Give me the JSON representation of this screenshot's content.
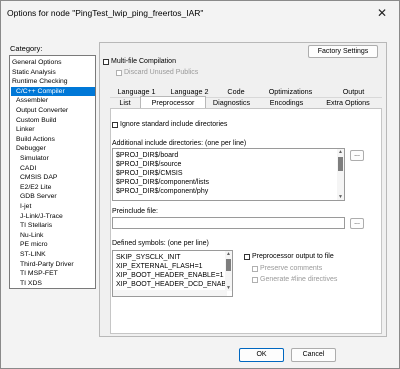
{
  "window": {
    "title": "Options for node \"PingTest_lwip_ping_freertos_IAR\"",
    "close_glyph": "✕"
  },
  "category": {
    "label": "Category:",
    "items": [
      {
        "text": "General Options",
        "indent": 0
      },
      {
        "text": "Static Analysis",
        "indent": 0
      },
      {
        "text": "Runtime Checking",
        "indent": 0
      },
      {
        "text": "C/C++ Compiler",
        "indent": 1,
        "selected": true
      },
      {
        "text": "Assembler",
        "indent": 1
      },
      {
        "text": "Output Converter",
        "indent": 1
      },
      {
        "text": "Custom Build",
        "indent": 1
      },
      {
        "text": "Linker",
        "indent": 1
      },
      {
        "text": "Build Actions",
        "indent": 1
      },
      {
        "text": "Debugger",
        "indent": 1
      },
      {
        "text": "Simulator",
        "indent": 2
      },
      {
        "text": "CADI",
        "indent": 2
      },
      {
        "text": "CMSIS DAP",
        "indent": 2
      },
      {
        "text": "E2/E2 Lite",
        "indent": 2
      },
      {
        "text": "GDB Server",
        "indent": 2
      },
      {
        "text": "I-jet",
        "indent": 2
      },
      {
        "text": "J-Link/J-Trace",
        "indent": 2
      },
      {
        "text": "TI Stellaris",
        "indent": 2
      },
      {
        "text": "Nu-Link",
        "indent": 2
      },
      {
        "text": "PE micro",
        "indent": 2
      },
      {
        "text": "ST-LINK",
        "indent": 2
      },
      {
        "text": "Third-Party Driver",
        "indent": 2
      },
      {
        "text": "TI MSP-FET",
        "indent": 2
      },
      {
        "text": "TI XDS",
        "indent": 2
      }
    ]
  },
  "panel": {
    "factory_settings": "Factory Settings",
    "multifile": "Multi-file Compilation",
    "discard": "Discard Unused Publics",
    "tabs_row1": [
      "Language 1",
      "Language 2",
      "Code",
      "Optimizations",
      "Output"
    ],
    "tabs_row2": [
      "List",
      "Preprocessor",
      "Diagnostics",
      "Encodings",
      "Extra Options"
    ],
    "active_tab": "Preprocessor",
    "ignore_std": "Ignore standard include directories",
    "include_label": "Additional include directories: (one per line)",
    "include_dirs": [
      "$PROJ_DIR$/board",
      "$PROJ_DIR$/source",
      "$PROJ_DIR$/CMSIS",
      "$PROJ_DIR$/component/lists",
      "$PROJ_DIR$/component/phy"
    ],
    "browse": "...",
    "preinclude_label": "Preinclude file:",
    "preinclude_value": "",
    "defined_label": "Defined symbols: (one per line)",
    "defined_symbols": [
      "SKIP_SYSCLK_INIT",
      "XIP_EXTERNAL_FLASH=1",
      "XIP_BOOT_HEADER_ENABLE=1",
      "XIP_BOOT_HEADER_DCD_ENABL"
    ],
    "pp_output": "Preprocessor output to file",
    "preserve_comments": "Preserve comments",
    "generate_line": "Generate #line directives"
  },
  "buttons": {
    "ok": "OK",
    "cancel": "Cancel"
  }
}
